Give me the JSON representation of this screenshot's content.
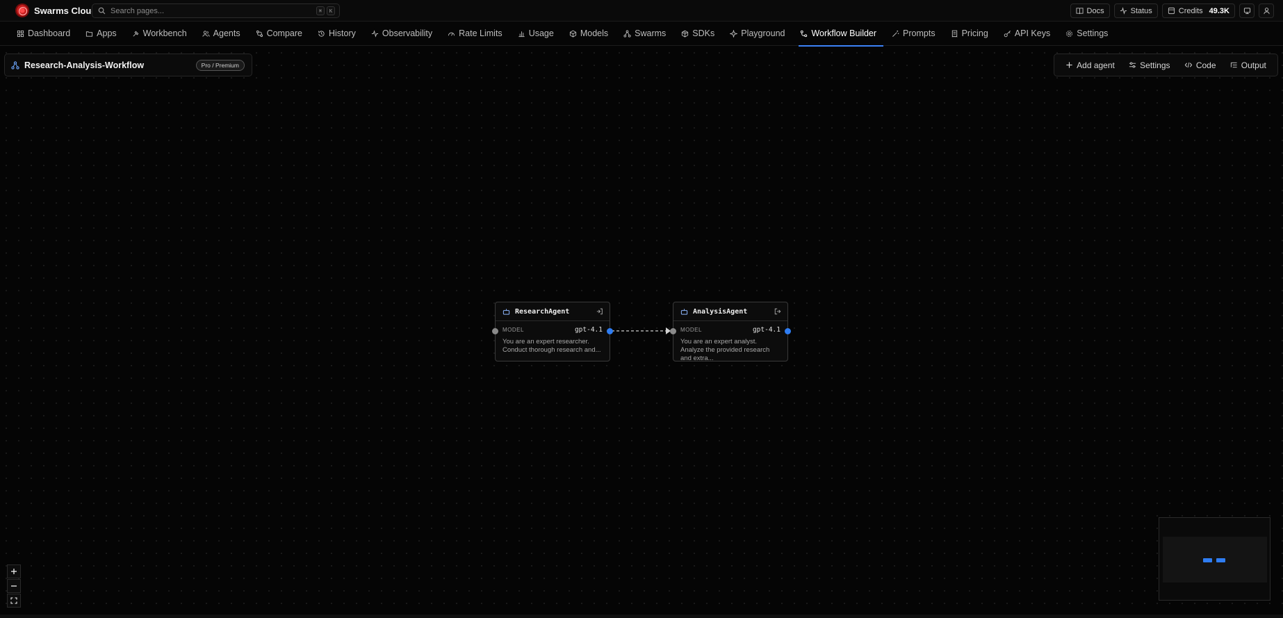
{
  "app": {
    "name": "Swarms Cloud",
    "search_placeholder": "Search pages...",
    "shortcut_keys": [
      "⌘",
      "K"
    ]
  },
  "topbar": {
    "docs_label": "Docs",
    "status_label": "Status",
    "credits_label": "Credits",
    "credits_value": "49.3K"
  },
  "nav": {
    "active": "Workflow Builder",
    "items": [
      {
        "label": "Dashboard",
        "icon": "grid-icon"
      },
      {
        "label": "Apps",
        "icon": "folder-icon"
      },
      {
        "label": "Workbench",
        "icon": "hammer-icon"
      },
      {
        "label": "Agents",
        "icon": "users-icon"
      },
      {
        "label": "Compare",
        "icon": "compare-icon"
      },
      {
        "label": "History",
        "icon": "history-icon"
      },
      {
        "label": "Observability",
        "icon": "activity-icon"
      },
      {
        "label": "Rate Limits",
        "icon": "gauge-icon"
      },
      {
        "label": "Usage",
        "icon": "bar-chart-icon"
      },
      {
        "label": "Models",
        "icon": "cube-icon"
      },
      {
        "label": "Swarms",
        "icon": "swarm-icon"
      },
      {
        "label": "SDKs",
        "icon": "package-icon"
      },
      {
        "label": "Playground",
        "icon": "sparkle-icon"
      },
      {
        "label": "Workflow Builder",
        "icon": "workflow-icon"
      },
      {
        "label": "Prompts",
        "icon": "wand-icon"
      },
      {
        "label": "Pricing",
        "icon": "receipt-icon"
      },
      {
        "label": "API Keys",
        "icon": "key-icon"
      },
      {
        "label": "Settings",
        "icon": "gear-icon"
      }
    ]
  },
  "workflow": {
    "title": "Research-Analysis-Workflow",
    "badge": "Pro / Premium"
  },
  "toolbar": {
    "add_agent": "Add agent",
    "settings": "Settings",
    "code": "Code",
    "output": "Output"
  },
  "nodes": [
    {
      "name": "ResearchAgent",
      "model_label": "MODEL",
      "model": "gpt-4.1",
      "description": "You are an expert researcher. Conduct thorough research and..."
    },
    {
      "name": "AnalysisAgent",
      "model_label": "MODEL",
      "model": "gpt-4.1",
      "description": "You are an expert analyst. Analyze the provided research and extra..."
    }
  ],
  "colors": {
    "accent": "#3b82f6",
    "handle_out": "#2f7df2",
    "handle_in": "#8a8a8a",
    "background": "#050505",
    "brand": "#c81e1e"
  }
}
